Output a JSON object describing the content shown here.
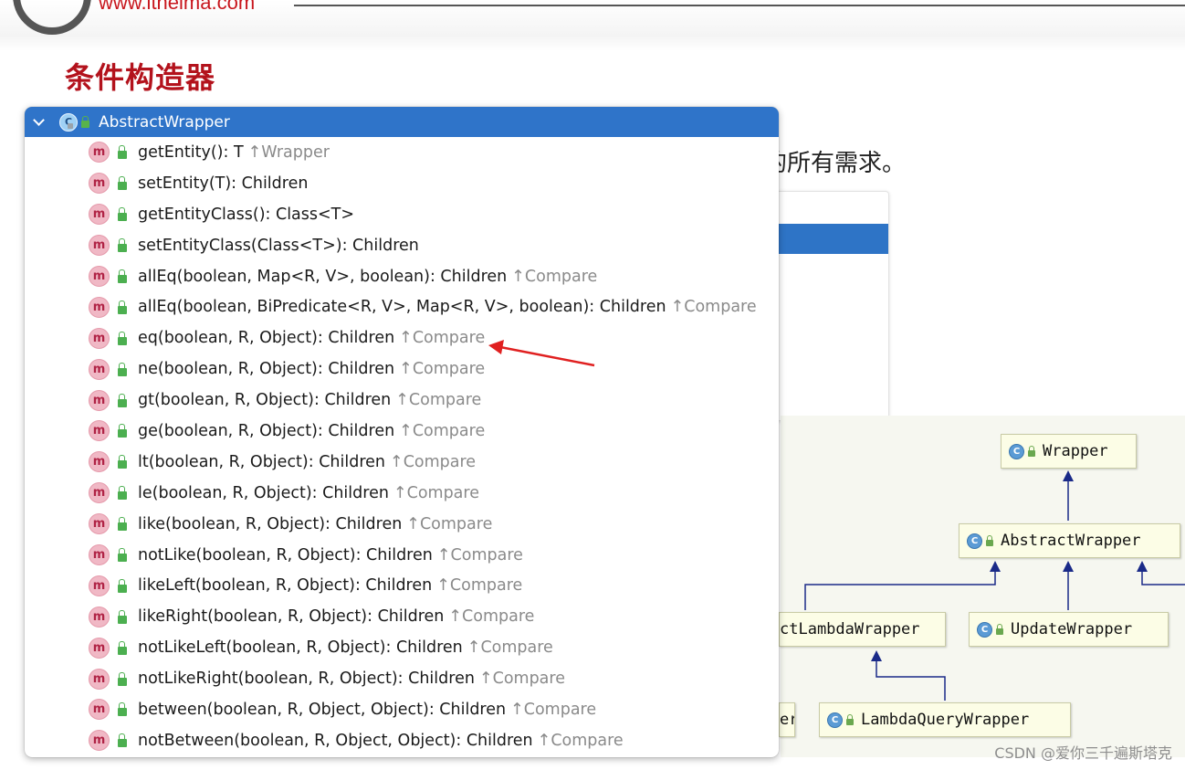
{
  "slide": {
    "site_url": "www.itheima.com",
    "title": "条件构造器",
    "sentence_fragment": "的所有需求。",
    "watermark": "CSDN @爱你三千遍斯塔克"
  },
  "popup": {
    "class_name": "AbstractWrapper",
    "class_icon_letter": "C",
    "method_icon_letter": "m",
    "items": [
      {
        "signature": "getEntity(): T",
        "owner": "↑Wrapper"
      },
      {
        "signature": "setEntity(T): Children",
        "owner": ""
      },
      {
        "signature": "getEntityClass(): Class<T>",
        "owner": ""
      },
      {
        "signature": "setEntityClass(Class<T>): Children",
        "owner": ""
      },
      {
        "signature": "allEq(boolean, Map<R, V>, boolean): Children",
        "owner": "↑Compare"
      },
      {
        "signature": "allEq(boolean, BiPredicate<R, V>, Map<R, V>, boolean): Children",
        "owner": "↑Compare"
      },
      {
        "signature": "eq(boolean, R, Object): Children",
        "owner": "↑Compare"
      },
      {
        "signature": "ne(boolean, R, Object): Children",
        "owner": "↑Compare"
      },
      {
        "signature": "gt(boolean, R, Object): Children",
        "owner": "↑Compare"
      },
      {
        "signature": "ge(boolean, R, Object): Children",
        "owner": "↑Compare"
      },
      {
        "signature": "lt(boolean, R, Object): Children",
        "owner": "↑Compare"
      },
      {
        "signature": "le(boolean, R, Object): Children",
        "owner": "↑Compare"
      },
      {
        "signature": "like(boolean, R, Object): Children",
        "owner": "↑Compare"
      },
      {
        "signature": "notLike(boolean, R, Object): Children",
        "owner": "↑Compare"
      },
      {
        "signature": "likeLeft(boolean, R, Object): Children",
        "owner": "↑Compare"
      },
      {
        "signature": "likeRight(boolean, R, Object): Children",
        "owner": "↑Compare"
      },
      {
        "signature": "notLikeLeft(boolean, R, Object): Children",
        "owner": "↑Compare"
      },
      {
        "signature": "notLikeRight(boolean, R, Object): Children",
        "owner": "↑Compare"
      },
      {
        "signature": "between(boolean, R, Object, Object): Children",
        "owner": "↑Compare"
      },
      {
        "signature": "notBetween(boolean, R, Object, Object): Children",
        "owner": "↑Compare"
      }
    ]
  },
  "uml": {
    "nodes": {
      "wrapper": "Wrapper",
      "abstract_wrapper": "AbstractWrapper",
      "lambda_wrapper": "ctLambdaWrapper",
      "update_wrapper": "UpdateWrapper",
      "er_node": "er",
      "lambda_query_wrapper": "LambdaQueryWrapper"
    }
  },
  "colors": {
    "title_red": "#b3121c",
    "popup_header_blue": "#2f74c9",
    "annotation_arrow_red": "#e02020"
  }
}
